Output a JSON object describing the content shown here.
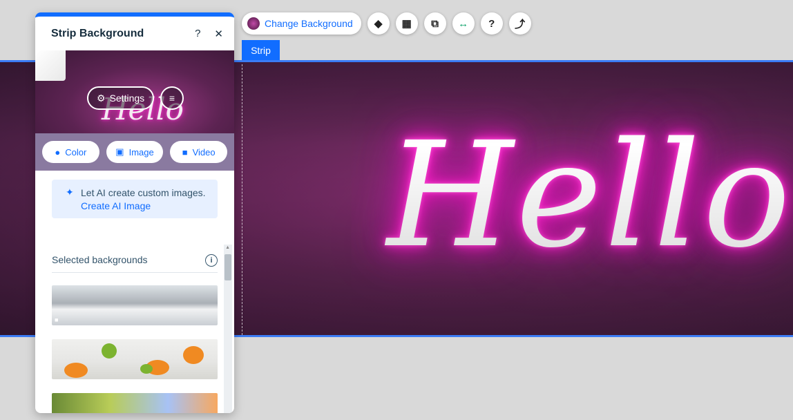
{
  "toolbar": {
    "change_background_label": "Change Background",
    "buttons": [
      {
        "icon": "arrange-icon",
        "glyph": "◆"
      },
      {
        "icon": "layout-icon",
        "glyph": "▦"
      },
      {
        "icon": "animation-icon",
        "glyph": "⧉"
      },
      {
        "icon": "stretch-icon",
        "glyph": "↔"
      },
      {
        "icon": "help-icon",
        "glyph": "?"
      },
      {
        "icon": "connect-icon",
        "glyph": "⤴"
      }
    ]
  },
  "strip_tag": "Strip",
  "canvas": {
    "neon_text": "Hello",
    "accent": "#116dff"
  },
  "panel": {
    "title": "Strip Background",
    "help_glyph": "?",
    "close_glyph": "✕",
    "preview_text": "Hello",
    "settings_label": "Settings",
    "media": [
      {
        "label": "Color",
        "glyph": "●"
      },
      {
        "label": "Image",
        "glyph": "▣"
      },
      {
        "label": "Video",
        "glyph": "■"
      }
    ],
    "ai": {
      "text": "Let AI create custom images.",
      "link": "Create AI Image",
      "glyph": "✦"
    },
    "selected_backgrounds_label": "Selected backgrounds",
    "info_glyph": "i"
  }
}
